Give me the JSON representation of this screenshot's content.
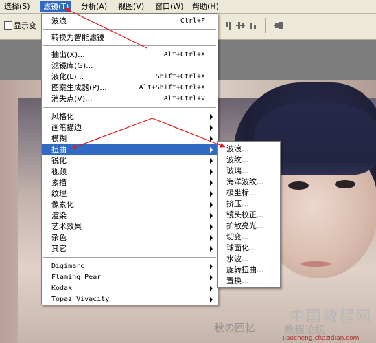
{
  "menubar": {
    "items": [
      "选择(S)",
      "滤镜(T)",
      "分析(A)",
      "视图(V)",
      "窗口(W)",
      "帮助(H)"
    ],
    "active_index": 1
  },
  "options_bar": {
    "show_transform_label": "显示变"
  },
  "filter_menu": {
    "last_filter": {
      "label": "波浪",
      "shortcut": "Ctrl+F"
    },
    "convert_smart": "转换为智能滤镜",
    "special": [
      {
        "label": "抽出(X)...",
        "shortcut": "Alt+Ctrl+X"
      },
      {
        "label": "滤镜库(G)...",
        "shortcut": ""
      },
      {
        "label": "液化(L)...",
        "shortcut": "Shift+Ctrl+X"
      },
      {
        "label": "图案生成器(P)...",
        "shortcut": "Alt+Shift+Ctrl+X"
      },
      {
        "label": "消失点(V)...",
        "shortcut": "Alt+Ctrl+V"
      }
    ],
    "groups": [
      "风格化",
      "画笔描边",
      "模糊",
      "扭曲",
      "锐化",
      "视频",
      "素描",
      "纹理",
      "像素化",
      "渲染",
      "艺术效果",
      "杂色",
      "其它"
    ],
    "highlighted_group": "扭曲",
    "plugins": [
      "Digimarc",
      "Flaming Pear",
      "Kodak",
      "Topaz Vivacity"
    ]
  },
  "distort_submenu": {
    "items": [
      "波浪...",
      "波纹...",
      "玻璃...",
      "海洋波纹...",
      "极坐标...",
      "挤压...",
      "镜头校正...",
      "扩散亮光...",
      "切变...",
      "球面化...",
      "水波...",
      "旋转扭曲...",
      "置换..."
    ]
  },
  "watermarks": {
    "signature": "秋の回忆",
    "site_cn": "中国教程网",
    "forum": "教程论坛",
    "url": "jiaocheng.chazidian.com"
  },
  "colors": {
    "menubar_bg": "#ece9d8",
    "highlight": "#316ac5",
    "annotation_red": "#e01818"
  }
}
